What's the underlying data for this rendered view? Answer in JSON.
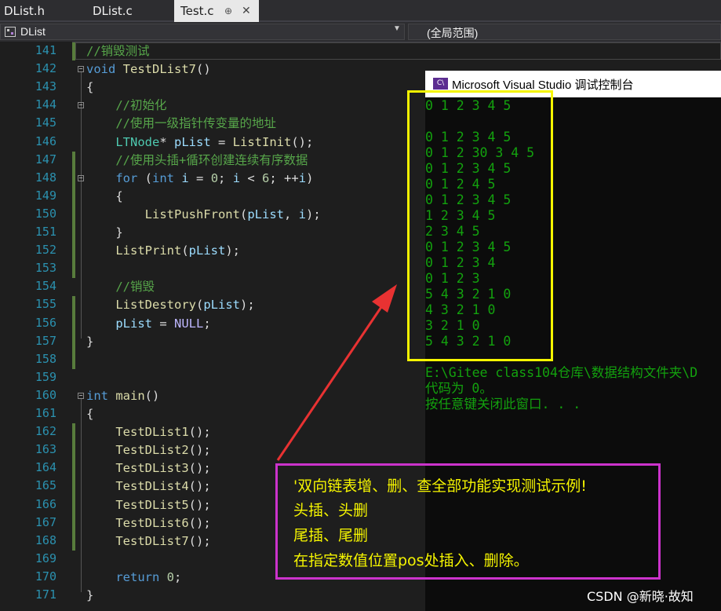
{
  "tabs": [
    {
      "label": "DList.h",
      "active": false
    },
    {
      "label": "DList.c",
      "active": false
    },
    {
      "label": "Test.c",
      "active": true
    }
  ],
  "tab_pin_icon": "⊕",
  "tab_close_icon": "✕",
  "nav": {
    "class_scope": "DList",
    "dropdown_caret": "▼",
    "global_scope": "(全局范围)"
  },
  "line_numbers": [
    "141",
    "142",
    "143",
    "144",
    "145",
    "146",
    "147",
    "148",
    "149",
    "150",
    "151",
    "152",
    "153",
    "154",
    "155",
    "156",
    "157",
    "158",
    "159",
    "160",
    "161",
    "162",
    "163",
    "164",
    "165",
    "166",
    "167",
    "168",
    "169",
    "170",
    "171"
  ],
  "code_lines": [
    {
      "indent": "",
      "tokens": [
        {
          "t": "//销毁测试",
          "c": "cm"
        }
      ]
    },
    {
      "indent": "",
      "tokens": [
        {
          "t": "void",
          "c": "kw"
        },
        {
          "t": " ",
          "c": ""
        },
        {
          "t": "TestDList7",
          "c": "fn"
        },
        {
          "t": "()",
          "c": ""
        }
      ]
    },
    {
      "indent": "",
      "tokens": [
        {
          "t": "{",
          "c": ""
        }
      ]
    },
    {
      "indent": "    ",
      "tokens": [
        {
          "t": "//初始化",
          "c": "cm"
        }
      ]
    },
    {
      "indent": "    ",
      "tokens": [
        {
          "t": "//使用一级指针传变量的地址",
          "c": "cm"
        }
      ]
    },
    {
      "indent": "    ",
      "tokens": [
        {
          "t": "LTNode",
          "c": "ty"
        },
        {
          "t": "* ",
          "c": ""
        },
        {
          "t": "pList",
          "c": "va"
        },
        {
          "t": " = ",
          "c": ""
        },
        {
          "t": "ListInit",
          "c": "fn"
        },
        {
          "t": "();",
          "c": ""
        }
      ]
    },
    {
      "indent": "    ",
      "tokens": [
        {
          "t": "//使用头插+循环创建连续有序数据",
          "c": "cm"
        }
      ]
    },
    {
      "indent": "    ",
      "tokens": [
        {
          "t": "for",
          "c": "kw"
        },
        {
          "t": " (",
          "c": ""
        },
        {
          "t": "int",
          "c": "kw"
        },
        {
          "t": " ",
          "c": ""
        },
        {
          "t": "i",
          "c": "va"
        },
        {
          "t": " = ",
          "c": ""
        },
        {
          "t": "0",
          "c": "nu"
        },
        {
          "t": "; ",
          "c": ""
        },
        {
          "t": "i",
          "c": "va"
        },
        {
          "t": " < ",
          "c": ""
        },
        {
          "t": "6",
          "c": "nu"
        },
        {
          "t": "; ++",
          "c": ""
        },
        {
          "t": "i",
          "c": "va"
        },
        {
          "t": ")",
          "c": ""
        }
      ]
    },
    {
      "indent": "    ",
      "tokens": [
        {
          "t": "{",
          "c": ""
        }
      ]
    },
    {
      "indent": "        ",
      "tokens": [
        {
          "t": "ListPushFront",
          "c": "fn"
        },
        {
          "t": "(",
          "c": ""
        },
        {
          "t": "pList",
          "c": "va"
        },
        {
          "t": ", ",
          "c": ""
        },
        {
          "t": "i",
          "c": "va"
        },
        {
          "t": ");",
          "c": ""
        }
      ]
    },
    {
      "indent": "    ",
      "tokens": [
        {
          "t": "}",
          "c": ""
        }
      ]
    },
    {
      "indent": "    ",
      "tokens": [
        {
          "t": "ListPrint",
          "c": "fn"
        },
        {
          "t": "(",
          "c": ""
        },
        {
          "t": "pList",
          "c": "va"
        },
        {
          "t": ");",
          "c": ""
        }
      ]
    },
    {
      "indent": "",
      "tokens": []
    },
    {
      "indent": "    ",
      "tokens": [
        {
          "t": "//销毁",
          "c": "cm"
        }
      ]
    },
    {
      "indent": "    ",
      "tokens": [
        {
          "t": "ListDestory",
          "c": "fn"
        },
        {
          "t": "(",
          "c": ""
        },
        {
          "t": "pList",
          "c": "va"
        },
        {
          "t": ");",
          "c": ""
        }
      ]
    },
    {
      "indent": "    ",
      "tokens": [
        {
          "t": "pList",
          "c": "va"
        },
        {
          "t": " = ",
          "c": ""
        },
        {
          "t": "NULL",
          "c": "ma"
        },
        {
          "t": ";",
          "c": ""
        }
      ]
    },
    {
      "indent": "",
      "tokens": [
        {
          "t": "}",
          "c": ""
        }
      ]
    },
    {
      "indent": "",
      "tokens": []
    },
    {
      "indent": "",
      "tokens": []
    },
    {
      "indent": "",
      "tokens": [
        {
          "t": "int",
          "c": "kw"
        },
        {
          "t": " ",
          "c": ""
        },
        {
          "t": "main",
          "c": "fn"
        },
        {
          "t": "()",
          "c": ""
        }
      ]
    },
    {
      "indent": "",
      "tokens": [
        {
          "t": "{",
          "c": ""
        }
      ]
    },
    {
      "indent": "    ",
      "tokens": [
        {
          "t": "TestDList1",
          "c": "fn"
        },
        {
          "t": "();",
          "c": ""
        }
      ]
    },
    {
      "indent": "    ",
      "tokens": [
        {
          "t": "TestDList2",
          "c": "fn"
        },
        {
          "t": "();",
          "c": ""
        }
      ]
    },
    {
      "indent": "    ",
      "tokens": [
        {
          "t": "TestDList3",
          "c": "fn"
        },
        {
          "t": "();",
          "c": ""
        }
      ]
    },
    {
      "indent": "    ",
      "tokens": [
        {
          "t": "TestDList4",
          "c": "fn"
        },
        {
          "t": "();",
          "c": ""
        }
      ]
    },
    {
      "indent": "    ",
      "tokens": [
        {
          "t": "TestDList5",
          "c": "fn"
        },
        {
          "t": "();",
          "c": ""
        }
      ]
    },
    {
      "indent": "    ",
      "tokens": [
        {
          "t": "TestDList6",
          "c": "fn"
        },
        {
          "t": "();",
          "c": ""
        }
      ]
    },
    {
      "indent": "    ",
      "tokens": [
        {
          "t": "TestDList7",
          "c": "fn"
        },
        {
          "t": "();",
          "c": ""
        }
      ]
    },
    {
      "indent": "",
      "tokens": []
    },
    {
      "indent": "    ",
      "tokens": [
        {
          "t": "return",
          "c": "kw"
        },
        {
          "t": " ",
          "c": ""
        },
        {
          "t": "0",
          "c": "nu"
        },
        {
          "t": ";",
          "c": ""
        }
      ]
    },
    {
      "indent": "",
      "tokens": [
        {
          "t": "}",
          "c": ""
        }
      ]
    }
  ],
  "fold_symbol": "−",
  "console": {
    "icon_label": "C\\",
    "title": "Microsoft Visual Studio 调试控制台",
    "output_lines": [
      "0 1 2 3 4 5",
      "",
      "0 1 2 3 4 5",
      "0 1 2 30 3 4 5",
      "0 1 2 3 4 5",
      "0 1 2 4 5",
      "0 1 2 3 4 5",
      "1 2 3 4 5",
      "2 3 4 5",
      "0 1 2 3 4 5",
      "0 1 2 3 4",
      "0 1 2 3",
      "5 4 3 2 1 0",
      "4 3 2 1 0",
      "3 2 1 0",
      "5 4 3 2 1 0",
      "",
      "E:\\Gitee class104仓库\\数据结构文件夹\\D",
      "代码为 0。",
      "按任意键关闭此窗口. . ."
    ]
  },
  "annotation": {
    "lines": [
      "'双向链表增、删、查全部功能实现测试示例!",
      " 头插、头删",
      " 尾插、尾删",
      " 在指定数值位置pos处插入、删除。"
    ],
    "highlight_color": "#f5f500",
    "box_color": "#cc33cc",
    "arrow_color": "#e83232"
  },
  "watermark": "CSDN @新晓·故知"
}
